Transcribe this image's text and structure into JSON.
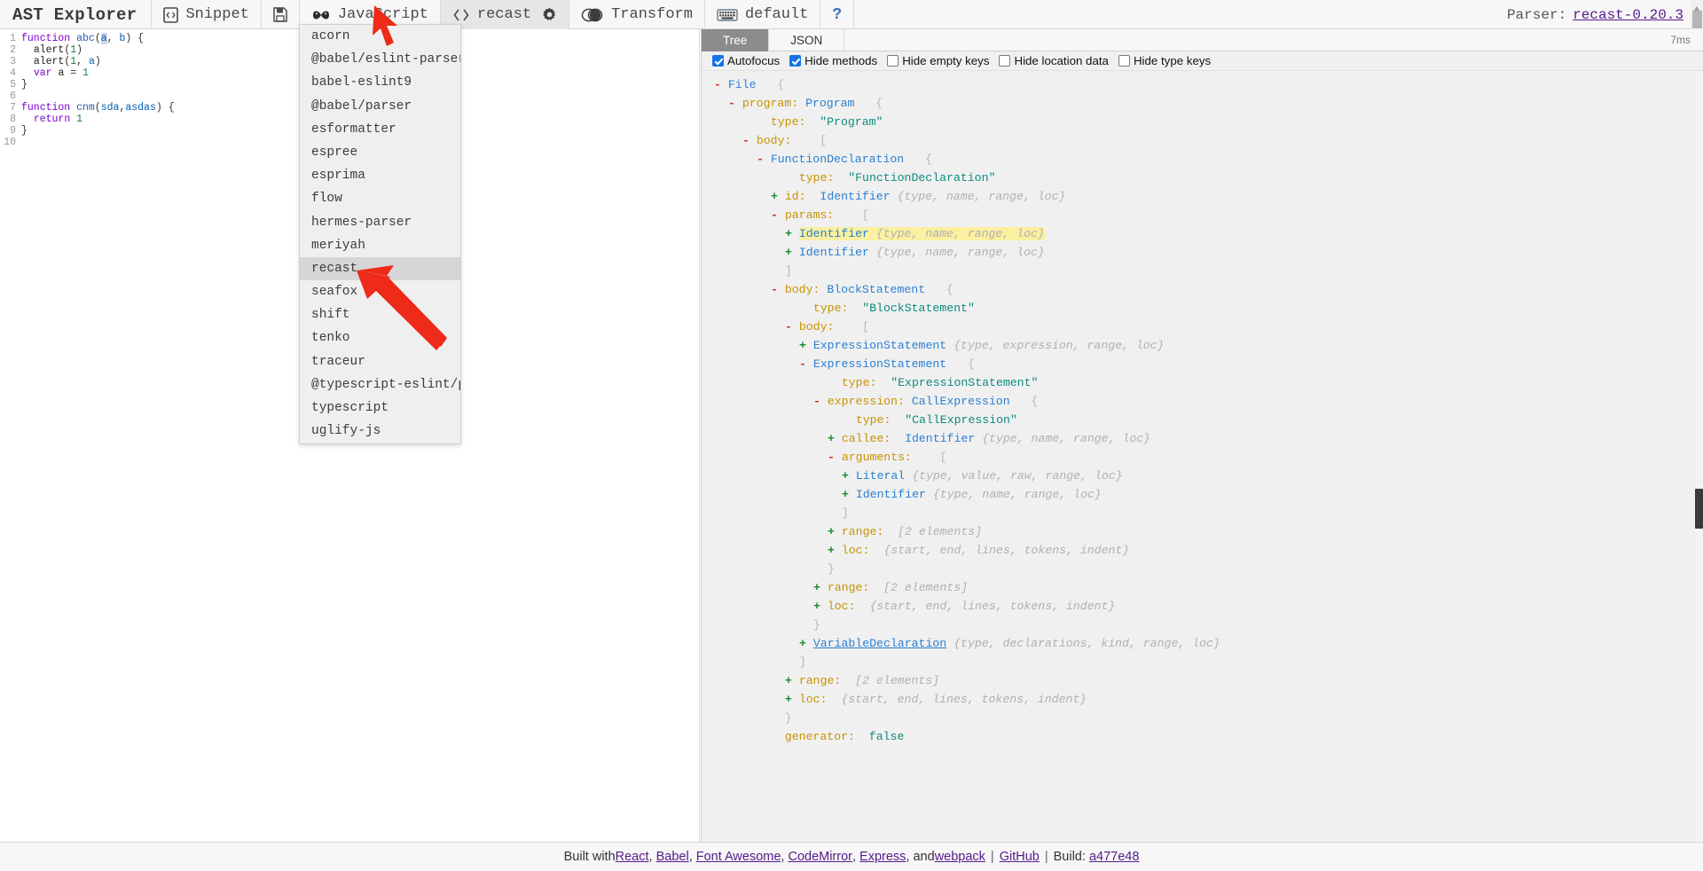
{
  "toolbar": {
    "brand": "AST Explorer",
    "snippet_label": "Snippet",
    "snippet_icon": "file-code-icon",
    "save_icon": "save-icon",
    "language_label": "JavaScript",
    "language_icon": "infinity-icon",
    "parser_label": "recast",
    "parser_icon": "code-brackets-icon",
    "settings_icon": "gear-icon",
    "transform_label": "Transform",
    "transform_icon": "toggle-icon",
    "keymap_label": "default",
    "keymap_icon": "keyboard-icon",
    "help_icon": "question-mark-icon",
    "parser_status_label": "Parser:",
    "parser_status_value": "recast-0.20.3"
  },
  "editor": {
    "lines": [
      {
        "n": "1",
        "tokens": [
          {
            "t": "function",
            "c": "kw"
          },
          {
            "t": " ",
            "c": "plain"
          },
          {
            "t": "abc",
            "c": "fn"
          },
          {
            "t": "(",
            "c": "punc"
          },
          {
            "t": "a",
            "c": "param sel"
          },
          {
            "t": ", ",
            "c": "punc"
          },
          {
            "t": "b",
            "c": "param"
          },
          {
            "t": ") {",
            "c": "punc"
          }
        ]
      },
      {
        "n": "2",
        "tokens": [
          {
            "t": "  ",
            "c": "plain"
          },
          {
            "t": "alert",
            "c": "plain"
          },
          {
            "t": "(",
            "c": "punc"
          },
          {
            "t": "1",
            "c": "num"
          },
          {
            "t": ")",
            "c": "punc"
          }
        ]
      },
      {
        "n": "3",
        "tokens": [
          {
            "t": "  ",
            "c": "plain"
          },
          {
            "t": "alert",
            "c": "plain"
          },
          {
            "t": "(",
            "c": "punc"
          },
          {
            "t": "1",
            "c": "num"
          },
          {
            "t": ", ",
            "c": "punc"
          },
          {
            "t": "a",
            "c": "param"
          },
          {
            "t": ")",
            "c": "punc"
          }
        ]
      },
      {
        "n": "4",
        "tokens": [
          {
            "t": "  ",
            "c": "plain"
          },
          {
            "t": "var",
            "c": "kw"
          },
          {
            "t": " ",
            "c": "plain"
          },
          {
            "t": "a",
            "c": "plain"
          },
          {
            "t": " = ",
            "c": "punc"
          },
          {
            "t": "1",
            "c": "num"
          }
        ]
      },
      {
        "n": "5",
        "tokens": [
          {
            "t": "}",
            "c": "punc"
          }
        ]
      },
      {
        "n": "6",
        "tokens": [
          {
            "t": "",
            "c": "plain"
          }
        ]
      },
      {
        "n": "7",
        "tokens": [
          {
            "t": "function",
            "c": "kw"
          },
          {
            "t": " ",
            "c": "plain"
          },
          {
            "t": "cnm",
            "c": "fn"
          },
          {
            "t": "(",
            "c": "punc"
          },
          {
            "t": "sda",
            "c": "param"
          },
          {
            "t": ",",
            "c": "punc"
          },
          {
            "t": "asdas",
            "c": "param"
          },
          {
            "t": ") {",
            "c": "punc"
          }
        ]
      },
      {
        "n": "8",
        "tokens": [
          {
            "t": "  ",
            "c": "plain"
          },
          {
            "t": "return",
            "c": "kw"
          },
          {
            "t": " ",
            "c": "plain"
          },
          {
            "t": "1",
            "c": "num"
          }
        ]
      },
      {
        "n": "9",
        "tokens": [
          {
            "t": "}",
            "c": "punc"
          }
        ]
      },
      {
        "n": "10",
        "tokens": [
          {
            "t": "",
            "c": "plain"
          }
        ]
      }
    ]
  },
  "parser_dropdown": {
    "selected": "recast",
    "items": [
      "acorn",
      "@babel/eslint-parser",
      "babel-eslint9",
      "@babel/parser",
      "esformatter",
      "espree",
      "esprima",
      "flow",
      "hermes-parser",
      "meriyah",
      "recast",
      "seafox",
      "shift",
      "tenko",
      "traceur",
      "@typescript-eslint/parser",
      "typescript",
      "uglify-js"
    ]
  },
  "ast_panel": {
    "tabs": [
      {
        "label": "Tree",
        "active": true
      },
      {
        "label": "JSON",
        "active": false
      }
    ],
    "parse_time": "7ms",
    "options": [
      {
        "label": "Autofocus",
        "checked": true
      },
      {
        "label": "Hide methods",
        "checked": true
      },
      {
        "label": "Hide empty keys",
        "checked": false
      },
      {
        "label": "Hide location data",
        "checked": false
      },
      {
        "label": "Hide type keys",
        "checked": false
      }
    ],
    "tree": [
      {
        "indent": 0,
        "toggle": "-",
        "parts": [
          {
            "t": "File",
            "c": "k-type"
          },
          {
            "t": "   ",
            "c": ""
          },
          {
            "t": "{",
            "c": "k-punc"
          }
        ]
      },
      {
        "indent": 1,
        "toggle": "-",
        "parts": [
          {
            "t": "program:",
            "c": "k-key"
          },
          {
            "t": " ",
            "c": ""
          },
          {
            "t": "Program",
            "c": "k-type"
          },
          {
            "t": "   ",
            "c": ""
          },
          {
            "t": "{",
            "c": "k-punc"
          }
        ]
      },
      {
        "indent": 3,
        "toggle": "",
        "parts": [
          {
            "t": "type:",
            "c": "k-key"
          },
          {
            "t": "  ",
            "c": ""
          },
          {
            "t": "\"Program\"",
            "c": "k-str"
          }
        ]
      },
      {
        "indent": 2,
        "toggle": "-",
        "parts": [
          {
            "t": "body:",
            "c": "k-key"
          },
          {
            "t": "    ",
            "c": ""
          },
          {
            "t": "[",
            "c": "k-punc"
          }
        ]
      },
      {
        "indent": 3,
        "toggle": "-",
        "parts": [
          {
            "t": "FunctionDeclaration",
            "c": "k-type"
          },
          {
            "t": "   ",
            "c": ""
          },
          {
            "t": "{",
            "c": "k-punc"
          }
        ]
      },
      {
        "indent": 5,
        "toggle": "",
        "parts": [
          {
            "t": "type:",
            "c": "k-key"
          },
          {
            "t": "  ",
            "c": ""
          },
          {
            "t": "\"FunctionDeclaration\"",
            "c": "k-str"
          }
        ]
      },
      {
        "indent": 4,
        "toggle": "+",
        "parts": [
          {
            "t": "id:",
            "c": "k-key"
          },
          {
            "t": "  ",
            "c": ""
          },
          {
            "t": "Identifier",
            "c": "k-type"
          },
          {
            "t": " ",
            "c": ""
          },
          {
            "t": "{type, name, range, loc}",
            "c": "k-prev"
          }
        ]
      },
      {
        "indent": 4,
        "toggle": "-",
        "parts": [
          {
            "t": "params:",
            "c": "k-key"
          },
          {
            "t": "    ",
            "c": ""
          },
          {
            "t": "[",
            "c": "k-punc"
          }
        ]
      },
      {
        "indent": 5,
        "toggle": "+",
        "highlight": true,
        "parts": [
          {
            "t": "Identifier",
            "c": "k-type"
          },
          {
            "t": " ",
            "c": ""
          },
          {
            "t": "{type, name, range, loc}",
            "c": "k-prev"
          }
        ]
      },
      {
        "indent": 5,
        "toggle": "+",
        "parts": [
          {
            "t": "Identifier",
            "c": "k-type"
          },
          {
            "t": " ",
            "c": ""
          },
          {
            "t": "{type, name, range, loc}",
            "c": "k-prev"
          }
        ]
      },
      {
        "indent": 4,
        "toggle": "",
        "parts": [
          {
            "t": "]",
            "c": "k-punc"
          }
        ]
      },
      {
        "indent": 4,
        "toggle": "-",
        "parts": [
          {
            "t": "body:",
            "c": "k-key"
          },
          {
            "t": " ",
            "c": ""
          },
          {
            "t": "BlockStatement",
            "c": "k-type"
          },
          {
            "t": "   ",
            "c": ""
          },
          {
            "t": "{",
            "c": "k-punc"
          }
        ]
      },
      {
        "indent": 6,
        "toggle": "",
        "parts": [
          {
            "t": "type:",
            "c": "k-key"
          },
          {
            "t": "  ",
            "c": ""
          },
          {
            "t": "\"BlockStatement\"",
            "c": "k-str"
          }
        ]
      },
      {
        "indent": 5,
        "toggle": "-",
        "parts": [
          {
            "t": "body:",
            "c": "k-key"
          },
          {
            "t": "    ",
            "c": ""
          },
          {
            "t": "[",
            "c": "k-punc"
          }
        ]
      },
      {
        "indent": 6,
        "toggle": "+",
        "parts": [
          {
            "t": "ExpressionStatement",
            "c": "k-type"
          },
          {
            "t": " ",
            "c": ""
          },
          {
            "t": "{type, expression, range, loc}",
            "c": "k-prev"
          }
        ]
      },
      {
        "indent": 6,
        "toggle": "-",
        "parts": [
          {
            "t": "ExpressionStatement",
            "c": "k-type"
          },
          {
            "t": "   ",
            "c": ""
          },
          {
            "t": "{",
            "c": "k-punc"
          }
        ]
      },
      {
        "indent": 8,
        "toggle": "",
        "parts": [
          {
            "t": "type:",
            "c": "k-key"
          },
          {
            "t": "  ",
            "c": ""
          },
          {
            "t": "\"ExpressionStatement\"",
            "c": "k-str"
          }
        ]
      },
      {
        "indent": 7,
        "toggle": "-",
        "parts": [
          {
            "t": "expression:",
            "c": "k-key"
          },
          {
            "t": " ",
            "c": ""
          },
          {
            "t": "CallExpression",
            "c": "k-type"
          },
          {
            "t": "   ",
            "c": ""
          },
          {
            "t": "{",
            "c": "k-punc"
          }
        ]
      },
      {
        "indent": 9,
        "toggle": "",
        "parts": [
          {
            "t": "type:",
            "c": "k-key"
          },
          {
            "t": "  ",
            "c": ""
          },
          {
            "t": "\"CallExpression\"",
            "c": "k-str"
          }
        ]
      },
      {
        "indent": 8,
        "toggle": "+",
        "parts": [
          {
            "t": "callee:",
            "c": "k-key"
          },
          {
            "t": "  ",
            "c": ""
          },
          {
            "t": "Identifier",
            "c": "k-type"
          },
          {
            "t": " ",
            "c": ""
          },
          {
            "t": "{type, name, range, loc}",
            "c": "k-prev"
          }
        ]
      },
      {
        "indent": 8,
        "toggle": "-",
        "parts": [
          {
            "t": "arguments:",
            "c": "k-key"
          },
          {
            "t": "    ",
            "c": ""
          },
          {
            "t": "[",
            "c": "k-punc"
          }
        ]
      },
      {
        "indent": 9,
        "toggle": "+",
        "parts": [
          {
            "t": "Literal",
            "c": "k-type"
          },
          {
            "t": " ",
            "c": ""
          },
          {
            "t": "{type, value, raw, range, loc}",
            "c": "k-prev"
          }
        ]
      },
      {
        "indent": 9,
        "toggle": "+",
        "parts": [
          {
            "t": "Identifier",
            "c": "k-type"
          },
          {
            "t": " ",
            "c": ""
          },
          {
            "t": "{type, name, range, loc}",
            "c": "k-prev"
          }
        ]
      },
      {
        "indent": 8,
        "toggle": "",
        "parts": [
          {
            "t": "]",
            "c": "k-punc"
          }
        ]
      },
      {
        "indent": 8,
        "toggle": "+",
        "parts": [
          {
            "t": "range:",
            "c": "k-key"
          },
          {
            "t": "  ",
            "c": ""
          },
          {
            "t": "[2 elements]",
            "c": "k-prev"
          }
        ]
      },
      {
        "indent": 8,
        "toggle": "+",
        "parts": [
          {
            "t": "loc:",
            "c": "k-key"
          },
          {
            "t": "  ",
            "c": ""
          },
          {
            "t": "{start, end, lines, tokens, indent}",
            "c": "k-prev"
          }
        ]
      },
      {
        "indent": 7,
        "toggle": "",
        "parts": [
          {
            "t": "}",
            "c": "k-punc"
          }
        ]
      },
      {
        "indent": 7,
        "toggle": "+",
        "parts": [
          {
            "t": "range:",
            "c": "k-key"
          },
          {
            "t": "  ",
            "c": ""
          },
          {
            "t": "[2 elements]",
            "c": "k-prev"
          }
        ]
      },
      {
        "indent": 7,
        "toggle": "+",
        "parts": [
          {
            "t": "loc:",
            "c": "k-key"
          },
          {
            "t": "  ",
            "c": ""
          },
          {
            "t": "{start, end, lines, tokens, indent}",
            "c": "k-prev"
          }
        ]
      },
      {
        "indent": 6,
        "toggle": "",
        "parts": [
          {
            "t": "}",
            "c": "k-punc"
          }
        ]
      },
      {
        "indent": 6,
        "toggle": "+",
        "parts": [
          {
            "t": "VariableDeclaration",
            "c": "k-link"
          },
          {
            "t": " ",
            "c": ""
          },
          {
            "t": "{type, declarations, kind, range, loc}",
            "c": "k-prev"
          }
        ]
      },
      {
        "indent": 5,
        "toggle": "",
        "parts": [
          {
            "t": "]",
            "c": "k-punc"
          }
        ]
      },
      {
        "indent": 5,
        "toggle": "+",
        "parts": [
          {
            "t": "range:",
            "c": "k-key"
          },
          {
            "t": "  ",
            "c": ""
          },
          {
            "t": "[2 elements]",
            "c": "k-prev"
          }
        ]
      },
      {
        "indent": 5,
        "toggle": "+",
        "parts": [
          {
            "t": "loc:",
            "c": "k-key"
          },
          {
            "t": "  ",
            "c": ""
          },
          {
            "t": "{start, end, lines, tokens, indent}",
            "c": "k-prev"
          }
        ]
      },
      {
        "indent": 4,
        "toggle": "",
        "parts": [
          {
            "t": "}",
            "c": "k-punc"
          }
        ]
      },
      {
        "indent": 4,
        "toggle": "",
        "parts": [
          {
            "t": "generator:",
            "c": "k-key"
          },
          {
            "t": "  ",
            "c": ""
          },
          {
            "t": "false",
            "c": "k-bool"
          }
        ]
      }
    ]
  },
  "footer": {
    "prefix": "Built with ",
    "links": [
      "React",
      "Babel",
      "Font Awesome",
      "CodeMirror",
      "Express"
    ],
    "and_text": ", and ",
    "webpack": "webpack",
    "github": "GitHub",
    "build_label": "Build:",
    "build_hash": "a477e48"
  },
  "colors": {
    "accent_blue": "#2a7fd4",
    "key_gold": "#c89200",
    "string_teal": "#0d8a7e",
    "highlight_yellow": "#faf0a0",
    "annotation_red": "#ee2a18",
    "selected_gray": "#d6d6d6"
  }
}
